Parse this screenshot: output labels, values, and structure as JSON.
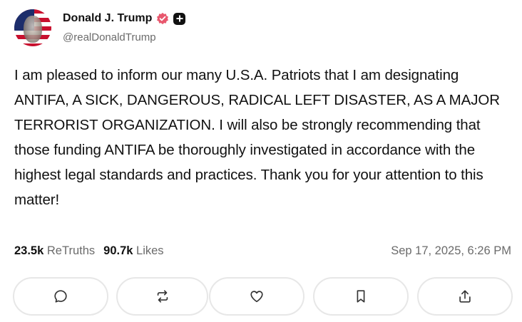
{
  "post": {
    "author": {
      "display_name": "Donald J. Trump",
      "handle": "@realDonaldTrump",
      "verified_badge_color": "#e8576d",
      "icons": [
        "verified-icon",
        "plus-badge-icon"
      ]
    },
    "text": "I am pleased to inform our many U.S.A. Patriots that I am designating ANTIFA, A SICK, DANGEROUS, RADICAL LEFT DISASTER, AS A MAJOR TERRORIST ORGANIZATION. I will also be strongly recommending that those funding ANTIFA be thoroughly investigated in accordance with the highest legal standards and practices. Thank you for your attention to this matter!",
    "stats": {
      "retruths_count": "23.5k",
      "retruths_label": "ReTruths",
      "likes_count": "90.7k",
      "likes_label": "Likes"
    },
    "timestamp": "Sep 17, 2025, 6:26 PM"
  },
  "actions": [
    {
      "name": "reply-button",
      "icon": "comment-icon"
    },
    {
      "name": "retruth-button",
      "icon": "repost-icon"
    },
    {
      "name": "like-button",
      "icon": "heart-icon"
    },
    {
      "name": "bookmark-button",
      "icon": "bookmark-icon"
    },
    {
      "name": "share-button",
      "icon": "share-icon"
    }
  ],
  "colors": {
    "text": "#111111",
    "muted": "#6b6b6b",
    "border": "#e7e7e7",
    "verified": "#e8576d"
  }
}
